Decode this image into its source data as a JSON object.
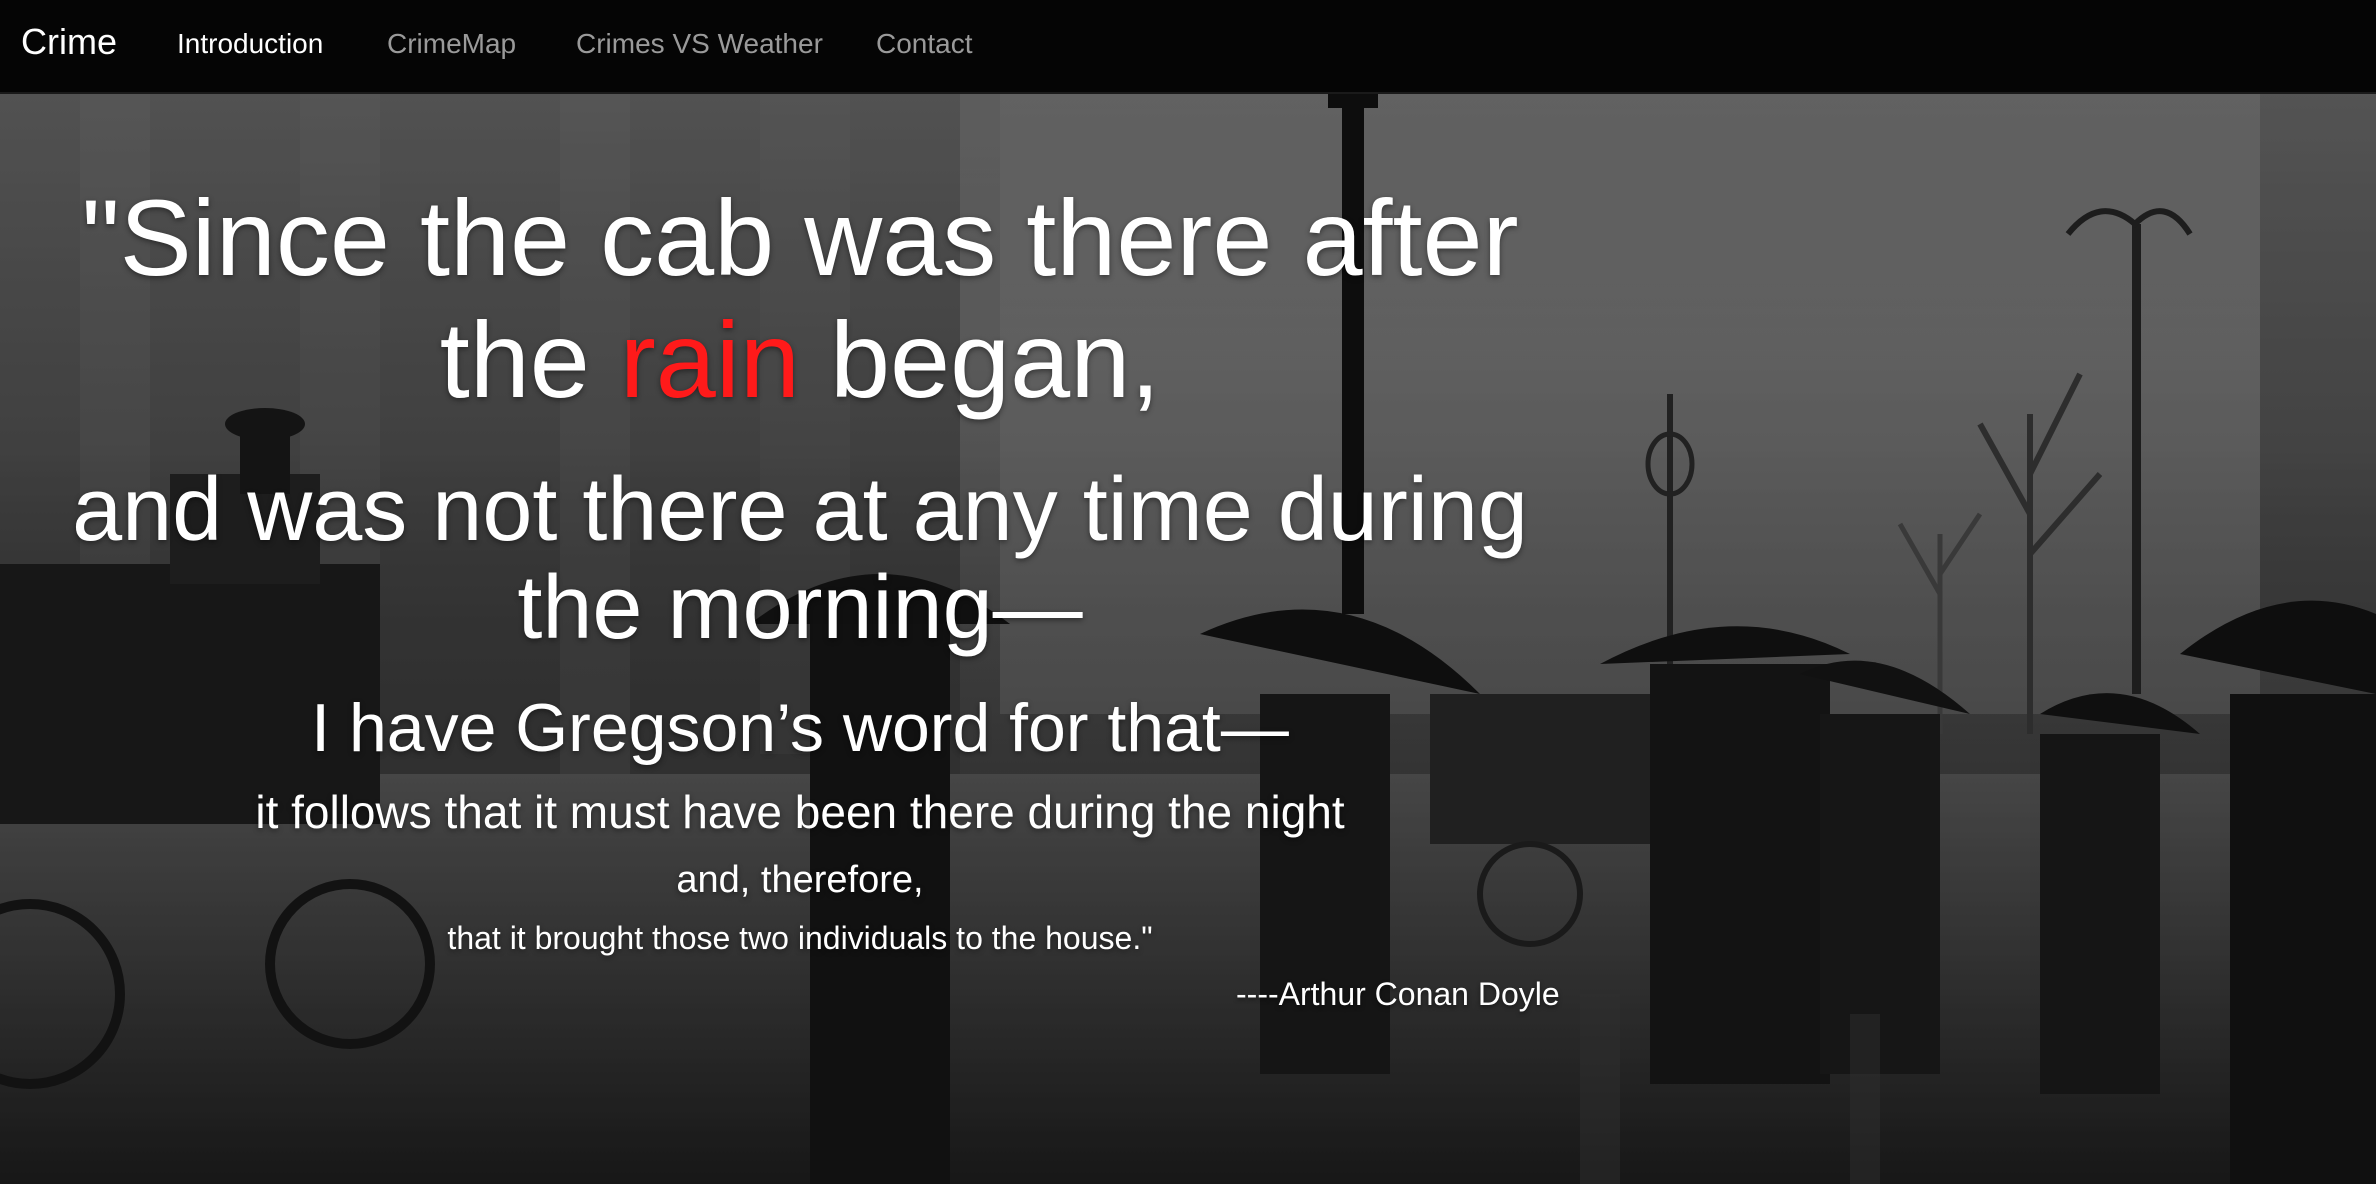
{
  "navbar": {
    "brand": "Crime",
    "items": [
      {
        "label": "Introduction",
        "active": true
      },
      {
        "label": "CrimeMap",
        "active": false
      },
      {
        "label": "Crimes VS Weather",
        "active": false
      },
      {
        "label": "Contact",
        "active": false
      }
    ]
  },
  "hero": {
    "quote": {
      "line1": "\"Since the cab was there after",
      "line2_before": "the ",
      "line2_highlight": "rain",
      "line2_after": " began,",
      "line3": "and was not there at any time during",
      "line4": "the morning—",
      "line5": "I have Gregson’s word for that—",
      "line6": "it follows that it must have been there during the night",
      "line7": "and, therefore,",
      "line8": "that it brought those two individuals to the house.\""
    },
    "author": "----Arthur Conan Doyle"
  },
  "colors": {
    "navbar_background": "#050505",
    "nav_active": "#ffffff",
    "nav_inactive": "#9a9a9a",
    "highlight": "#ff1a1a"
  }
}
